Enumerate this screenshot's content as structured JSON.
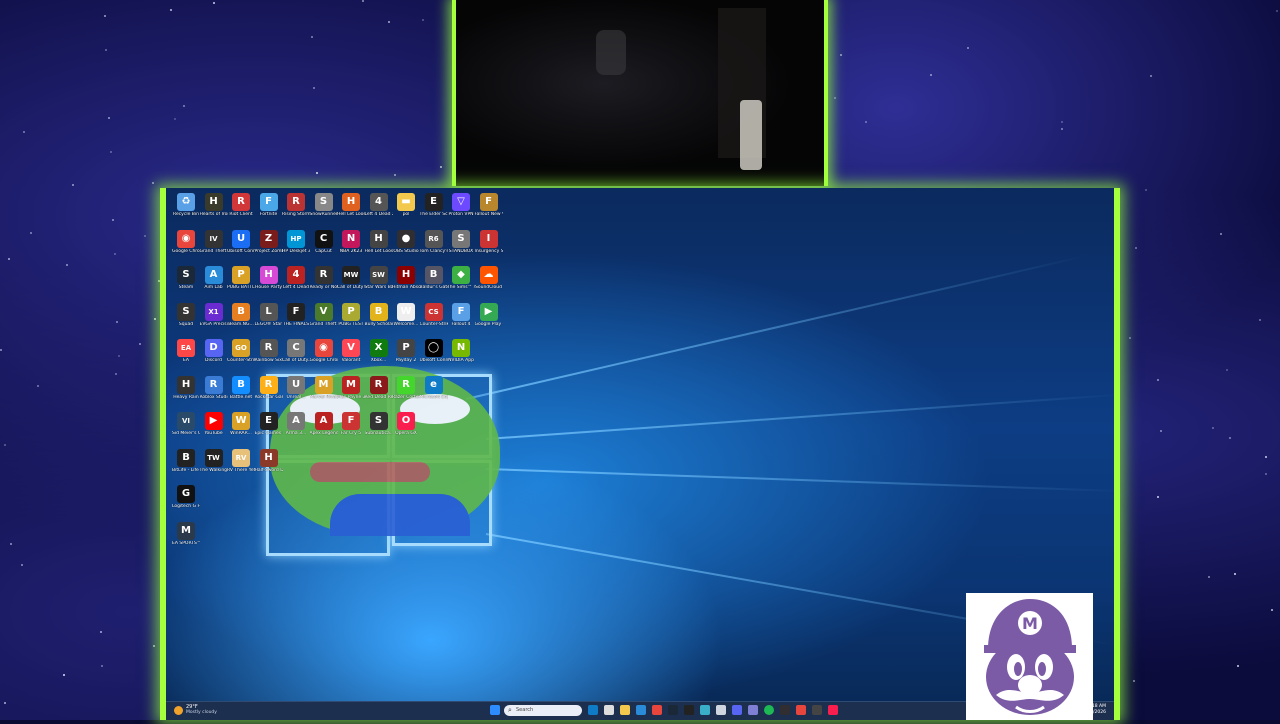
{
  "desktop_icons": [
    {
      "label": "Recycle Bin",
      "icon": "recycle-bin-icon",
      "color": "#5aa0e6",
      "glyph": "♻"
    },
    {
      "label": "Hearts of Iron IV",
      "icon": "game-icon",
      "color": "#3a3a2a",
      "glyph": "H"
    },
    {
      "label": "Riot Client",
      "icon": "riot-icon",
      "color": "#d13639",
      "glyph": "R"
    },
    {
      "label": "Fortnite",
      "icon": "fortnite-icon",
      "color": "#4aa8e8",
      "glyph": "F"
    },
    {
      "label": "Rising Storm 2 Vietnam",
      "icon": "game-icon",
      "color": "#b33",
      "glyph": "R"
    },
    {
      "label": "SnowRunner",
      "icon": "game-icon",
      "color": "#888",
      "glyph": "S"
    },
    {
      "label": "Hell Let Loose",
      "icon": "game-icon",
      "color": "#e06020",
      "glyph": "H"
    },
    {
      "label": "Left 4 Dead 2",
      "icon": "game-icon",
      "color": "#555",
      "glyph": "4"
    },
    {
      "label": "pol",
      "icon": "folder-icon",
      "color": "#f2c94c",
      "glyph": "▬"
    },
    {
      "label": "The Elder Scrolls ...",
      "icon": "game-icon",
      "color": "#222",
      "glyph": "E"
    },
    {
      "label": "Proton VPN",
      "icon": "vpn-icon",
      "color": "#6d4aff",
      "glyph": "▽"
    },
    {
      "label": "Fallout New Vegas",
      "icon": "game-icon",
      "color": "#b8862c",
      "glyph": "F"
    },
    {
      "label": "Google Chrome",
      "icon": "chrome-icon",
      "color": "#e8453c",
      "glyph": "◉"
    },
    {
      "label": "Grand Theft Auto IV T...",
      "icon": "game-icon",
      "color": "#333",
      "glyph": "IV"
    },
    {
      "label": "Ubisoft Connect",
      "icon": "ubisoft-icon",
      "color": "#1b6ef3",
      "glyph": "U"
    },
    {
      "label": "Project Zomboid",
      "icon": "game-icon",
      "color": "#7a1c1c",
      "glyph": "Z"
    },
    {
      "label": "HP Deskjet 3700 series",
      "icon": "printer-icon",
      "color": "#0096d6",
      "glyph": "HP"
    },
    {
      "label": "CapCut",
      "icon": "capcut-icon",
      "color": "#111",
      "glyph": "C"
    },
    {
      "label": "NBA 2K23",
      "icon": "game-icon",
      "color": "#c2185b",
      "glyph": "N"
    },
    {
      "label": "Hell Let Loose",
      "icon": "game-icon",
      "color": "#444",
      "glyph": "H"
    },
    {
      "label": "OBS Studio",
      "icon": "obs-icon",
      "color": "#302e31",
      "glyph": "●"
    },
    {
      "label": "Tom Clancy's Rainbow Si...",
      "icon": "game-icon",
      "color": "#555",
      "glyph": "R6"
    },
    {
      "label": "STANDBOX",
      "icon": "game-icon",
      "color": "#777",
      "glyph": "S"
    },
    {
      "label": "Insurgency Sandstorm",
      "icon": "game-icon",
      "color": "#c33",
      "glyph": "I"
    },
    {
      "label": "Steam",
      "icon": "steam-icon",
      "color": "#1b2838",
      "glyph": "S"
    },
    {
      "label": "Aim Lab",
      "icon": "aimlab-icon",
      "color": "#2a8bd8",
      "glyph": "A"
    },
    {
      "label": "PUBG BATTLEGR...",
      "icon": "game-icon",
      "color": "#d9a227",
      "glyph": "P"
    },
    {
      "label": "House Party",
      "icon": "game-icon",
      "color": "#d64ad6",
      "glyph": "H"
    },
    {
      "label": "Left 4 Dead",
      "icon": "game-icon",
      "color": "#b22",
      "glyph": "4"
    },
    {
      "label": "Ready or Not",
      "icon": "game-icon",
      "color": "#333",
      "glyph": "R"
    },
    {
      "label": "Call of Duty® M...",
      "icon": "game-icon",
      "color": "#222",
      "glyph": "MW"
    },
    {
      "label": "Star Wars Battlefront...",
      "icon": "game-icon",
      "color": "#444",
      "glyph": "SW"
    },
    {
      "label": "Hitman Absolution",
      "icon": "game-icon",
      "color": "#8b0000",
      "glyph": "H"
    },
    {
      "label": "Baldur's Gate 3",
      "icon": "game-icon",
      "color": "#556",
      "glyph": "B"
    },
    {
      "label": "The Sims™ 4",
      "icon": "sims-icon",
      "color": "#3cb043",
      "glyph": "◆"
    },
    {
      "label": "SoundCloud",
      "icon": "soundcloud-icon",
      "color": "#ff5500",
      "glyph": "☁"
    },
    {
      "label": "Squad",
      "icon": "game-icon",
      "color": "#333",
      "glyph": "S"
    },
    {
      "label": "EVGA Precision X1",
      "icon": "evga-icon",
      "color": "#6a2bd0",
      "glyph": "X1"
    },
    {
      "label": "Beam.NG...",
      "icon": "game-icon",
      "color": "#e67e22",
      "glyph": "B"
    },
    {
      "label": "LEGO® Star Wars™ Th...",
      "icon": "game-icon",
      "color": "#555",
      "glyph": "L"
    },
    {
      "label": "THE FINALS",
      "icon": "game-icon",
      "color": "#222",
      "glyph": "F"
    },
    {
      "label": "Grand Theft Auto V",
      "icon": "game-icon",
      "color": "#4a7a2a",
      "glyph": "V"
    },
    {
      "label": "PUBG TEST",
      "icon": "game-icon",
      "color": "#aa3",
      "glyph": "P"
    },
    {
      "label": "Bully Scholarship...",
      "icon": "game-icon",
      "color": "#e3b31b",
      "glyph": "B"
    },
    {
      "label": "Welcome...",
      "icon": "app-icon",
      "color": "#eee",
      "glyph": "W"
    },
    {
      "label": "Counter-Strike 2",
      "icon": "game-icon",
      "color": "#c33",
      "glyph": "CS"
    },
    {
      "label": "Fallout 4",
      "icon": "game-icon",
      "color": "#5aa0e6",
      "glyph": "F"
    },
    {
      "label": "Google Play Games",
      "icon": "playgames-icon",
      "color": "#34a853",
      "glyph": "▶"
    },
    {
      "label": "EA",
      "icon": "ea-icon",
      "color": "#ff4747",
      "glyph": "EA"
    },
    {
      "label": "Discord",
      "icon": "discord-icon",
      "color": "#5865f2",
      "glyph": "D"
    },
    {
      "label": "Counter-Strike Global Off...",
      "icon": "game-icon",
      "color": "#d9a227",
      "glyph": "GO"
    },
    {
      "label": "Rainbow Six...",
      "icon": "game-icon",
      "color": "#555",
      "glyph": "R"
    },
    {
      "label": "Call of Duty...",
      "icon": "game-icon",
      "color": "#777",
      "glyph": "C"
    },
    {
      "label": "Google Chrome",
      "icon": "chrome-icon",
      "color": "#e8453c",
      "glyph": "◉"
    },
    {
      "label": "Valorant",
      "icon": "game-icon",
      "color": "#ff4655",
      "glyph": "V"
    },
    {
      "label": "Xbox...",
      "icon": "xbox-icon",
      "color": "#107c10",
      "glyph": "X"
    },
    {
      "label": "Payday 2",
      "icon": "game-icon",
      "color": "#444",
      "glyph": "P"
    },
    {
      "label": "Ubisoft Connect",
      "icon": "ubisoft-icon",
      "color": "#000",
      "glyph": "◯"
    },
    {
      "label": "NVIDIA App",
      "icon": "nvidia-icon",
      "color": "#76b900",
      "glyph": "N"
    },
    {
      "label": "Heavy Rain",
      "icon": "game-icon",
      "color": "#333",
      "glyph": "H"
    },
    {
      "label": "Roblox Studio",
      "icon": "roblox-icon",
      "color": "#3a7bd5",
      "glyph": "R"
    },
    {
      "label": "Battle.net",
      "icon": "battlenet-icon",
      "color": "#148eff",
      "glyph": "B"
    },
    {
      "label": "Rockstar Games...",
      "icon": "rockstar-icon",
      "color": "#fcaf17",
      "glyph": "R"
    },
    {
      "label": "Unreal...",
      "icon": "game-icon",
      "color": "#777",
      "glyph": "U"
    },
    {
      "label": "Marvel Rivals",
      "icon": "game-icon",
      "color": "#d9a227",
      "glyph": "M"
    },
    {
      "label": "Max Payne 3",
      "icon": "game-icon",
      "color": "#b22",
      "glyph": "M"
    },
    {
      "label": "Red Dead Redemption 2",
      "icon": "game-icon",
      "color": "#8b1a1a",
      "glyph": "R"
    },
    {
      "label": "Razer Cortex...",
      "icon": "razer-icon",
      "color": "#44d62c",
      "glyph": "R"
    },
    {
      "label": "Microsoft Edge",
      "icon": "edge-icon",
      "color": "#0f7ac6",
      "glyph": "e"
    },
    {
      "label": "Sid Meier's Civilization VI",
      "icon": "game-icon",
      "color": "#2a4a6a",
      "glyph": "VI"
    },
    {
      "label": "YouTube",
      "icon": "youtube-icon",
      "color": "#ff0000",
      "glyph": "▶"
    },
    {
      "label": "WinRAR...",
      "icon": "winrar-icon",
      "color": "#d9a227",
      "glyph": "W"
    },
    {
      "label": "Epic Games Launcher",
      "icon": "epic-icon",
      "color": "#222",
      "glyph": "E"
    },
    {
      "label": "Arma 3...",
      "icon": "game-icon",
      "color": "#777",
      "glyph": "A"
    },
    {
      "label": "Apex Legends",
      "icon": "game-icon",
      "color": "#b22",
      "glyph": "A"
    },
    {
      "label": "Far Cry 5",
      "icon": "game-icon",
      "color": "#c33",
      "glyph": "F"
    },
    {
      "label": "Subnautica...",
      "icon": "game-icon",
      "color": "#333",
      "glyph": "S"
    },
    {
      "label": "Opera GX",
      "icon": "operagx-icon",
      "color": "#fa1e4e",
      "glyph": "O"
    },
    {
      "label": "BitLife - Life Simulator",
      "icon": "game-icon",
      "color": "#222",
      "glyph": "B"
    },
    {
      "label": "The Walking Dead The...",
      "icon": "game-icon",
      "color": "#222",
      "glyph": "TW"
    },
    {
      "label": "RV There Yet",
      "icon": "game-icon",
      "color": "#e7c07a",
      "glyph": "RV"
    },
    {
      "label": "Half-Sword Demo",
      "icon": "game-icon",
      "color": "#8b3a2a",
      "glyph": "H"
    },
    {
      "label": "Logitech G HUB",
      "icon": "logitech-icon",
      "color": "#111",
      "glyph": "G"
    },
    {
      "label": "EA SPORTS™ Madden N...",
      "icon": "game-icon",
      "color": "#2a3a4a",
      "glyph": "M"
    }
  ],
  "taskbar": {
    "weather_temp": "29°F",
    "weather_cond": "Mostly cloudy",
    "search_placeholder": "Search",
    "time": "12:18 AM",
    "date": "1/8/2026"
  },
  "colors": {
    "frame_glow": "#a6ff3d",
    "taskbar_bg": "#1d2f4f",
    "mario_purple": "#7b5aa6"
  }
}
